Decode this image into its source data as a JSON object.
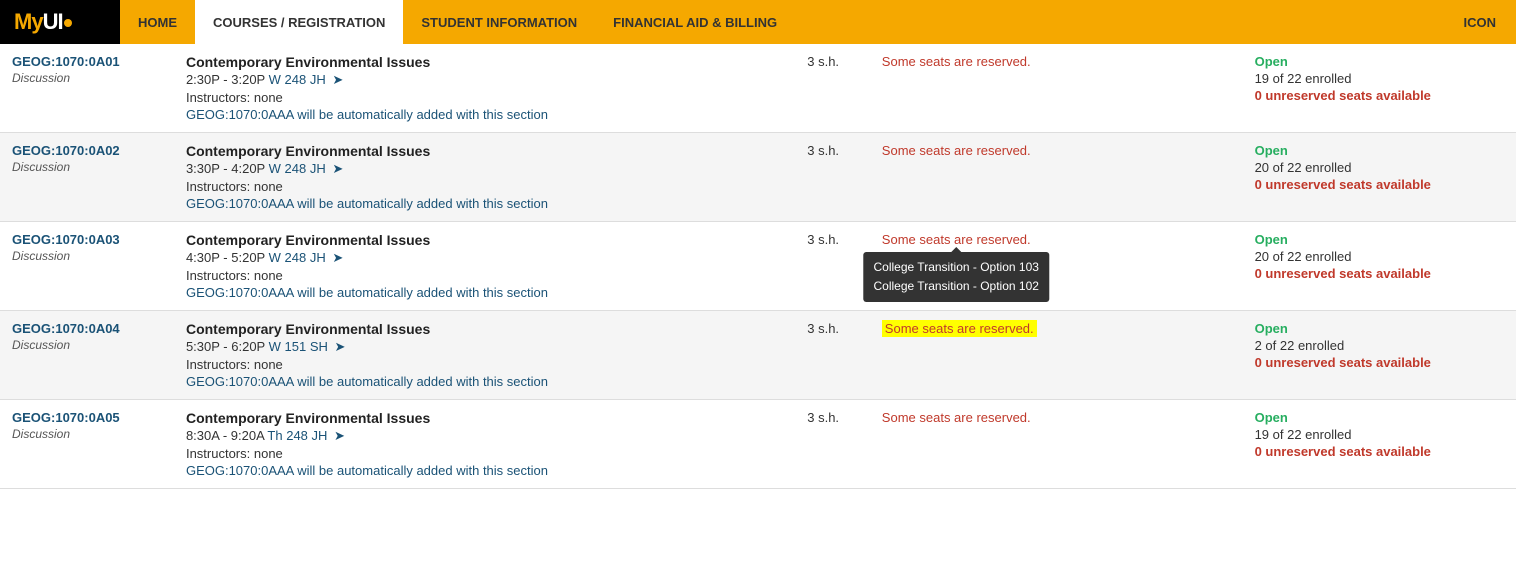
{
  "navbar": {
    "logo": "MyUI",
    "items": [
      {
        "label": "HOME",
        "active": false
      },
      {
        "label": "COURSES / REGISTRATION",
        "active": true
      },
      {
        "label": "STUDENT INFORMATION",
        "active": false
      },
      {
        "label": "FINANCIAL AID & BILLING",
        "active": false
      }
    ],
    "icon_label": "ICON"
  },
  "courses": [
    {
      "id": "GEOG:1070:0A01",
      "type": "Discussion",
      "title": "Contemporary Environmental Issues",
      "time": "2:30P - 3:20P",
      "days": "W",
      "room": "248 JH",
      "instructors": "Instructors: none",
      "auto_add": "GEOG:1070:0AAA will be automatically added with this section",
      "credits": "3 s.h.",
      "seats_status": "Some seats are reserved.",
      "highlighted": false,
      "tooltip": false,
      "status": "Open",
      "enrolled": "19 of 22 enrolled",
      "unreserved": "0 unreserved seats available"
    },
    {
      "id": "GEOG:1070:0A02",
      "type": "Discussion",
      "title": "Contemporary Environmental Issues",
      "time": "3:30P - 4:20P",
      "days": "W",
      "room": "248 JH",
      "instructors": "Instructors: none",
      "auto_add": "GEOG:1070:0AAA will be automatically added with this section",
      "credits": "3 s.h.",
      "seats_status": "Some seats are reserved.",
      "highlighted": false,
      "tooltip": false,
      "status": "Open",
      "enrolled": "20 of 22 enrolled",
      "unreserved": "0 unreserved seats available"
    },
    {
      "id": "GEOG:1070:0A03",
      "type": "Discussion",
      "title": "Contemporary Environmental Issues",
      "time": "4:30P - 5:20P",
      "days": "W",
      "room": "248 JH",
      "instructors": "Instructors: none",
      "auto_add": "GEOG:1070:0AAA will be automatically added with this section",
      "credits": "3 s.h.",
      "seats_status": "Some seats are reserved.",
      "highlighted": false,
      "tooltip": true,
      "tooltip_lines": [
        "College Transition - Option 103",
        "College Transition - Option 102"
      ],
      "status": "Open",
      "enrolled": "20 of 22 enrolled",
      "unreserved": "0 unreserved seats available"
    },
    {
      "id": "GEOG:1070:0A04",
      "type": "Discussion",
      "title": "Contemporary Environmental Issues",
      "time": "5:30P - 6:20P",
      "days": "W",
      "room": "151 SH",
      "instructors": "Instructors: none",
      "auto_add": "GEOG:1070:0AAA will be automatically added with this section",
      "credits": "3 s.h.",
      "seats_status": "Some seats are reserved.",
      "highlighted": true,
      "tooltip": false,
      "status": "Open",
      "enrolled": "2 of 22 enrolled",
      "unreserved": "0 unreserved seats available"
    },
    {
      "id": "GEOG:1070:0A05",
      "type": "Discussion",
      "title": "Contemporary Environmental Issues",
      "time": "8:30A - 9:20A",
      "days": "Th",
      "room": "248 JH",
      "instructors": "Instructors: none",
      "auto_add": "GEOG:1070:0AAA will be automatically added with this section",
      "credits": "3 s.h.",
      "seats_status": "Some seats are reserved.",
      "highlighted": false,
      "tooltip": false,
      "status": "Open",
      "enrolled": "19 of 22 enrolled",
      "unreserved": "0 unreserved seats available"
    }
  ]
}
